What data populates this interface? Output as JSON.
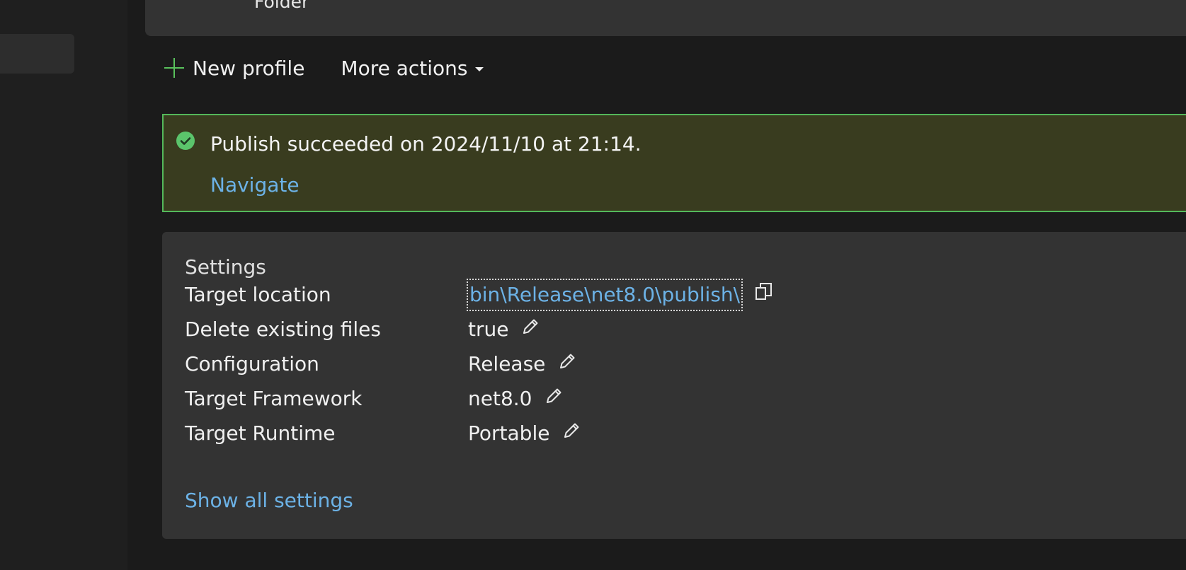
{
  "profile": {
    "kind_label": "Folder"
  },
  "toolbar": {
    "new_profile_label": "New profile",
    "more_actions_label": "More actions"
  },
  "banner": {
    "message": "Publish succeeded on 2024/11/10 at 21:14.",
    "navigate_link": "Navigate",
    "status": "success",
    "status_icon": "check-circle-icon"
  },
  "settings": {
    "title": "Settings",
    "rows": [
      {
        "label": "Target location",
        "value": "bin\\Release\\net8.0\\publish\\",
        "action_icon": "copy-icon"
      },
      {
        "label": "Delete existing files",
        "value": "true",
        "action_icon": "pencil-icon"
      },
      {
        "label": "Configuration",
        "value": "Release",
        "action_icon": "pencil-icon"
      },
      {
        "label": "Target Framework",
        "value": "net8.0",
        "action_icon": "pencil-icon"
      },
      {
        "label": "Target Runtime",
        "value": "Portable",
        "action_icon": "pencil-icon"
      }
    ],
    "show_all_link": "Show all settings"
  },
  "colors": {
    "background": "#1b1b1b",
    "card": "#333333",
    "banner_bg": "#393c1f",
    "banner_border": "#54b85a",
    "success_icon": "#5bc46b",
    "plus_icon": "#59c25c",
    "link": "#6cb2e6",
    "text": "#f0f0f0"
  }
}
